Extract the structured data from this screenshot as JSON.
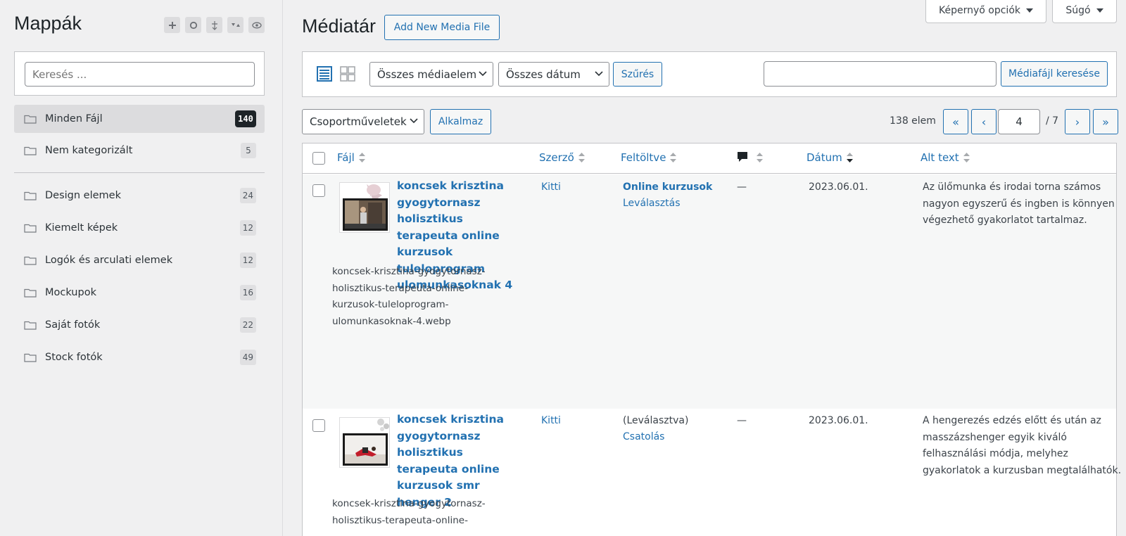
{
  "sidebar": {
    "title": "Mappák",
    "tools": [
      "+",
      "○",
      "⇣",
      "▾▴",
      "👁"
    ],
    "search_placeholder": "Keresés ...",
    "folders_top": [
      {
        "label": "Minden Fájl",
        "count": "140"
      },
      {
        "label": "Nem kategorizált",
        "count": "5"
      }
    ],
    "folders": [
      {
        "label": "Design elemek",
        "count": "24"
      },
      {
        "label": "Kiemelt képek",
        "count": "12"
      },
      {
        "label": "Logók és arculati elemek",
        "count": "12"
      },
      {
        "label": "Mockupok",
        "count": "16"
      },
      {
        "label": "Saját fotók",
        "count": "22"
      },
      {
        "label": "Stock fotók",
        "count": "49"
      }
    ]
  },
  "header": {
    "title": "Médiatár",
    "add_new": "Add New Media File",
    "screen_options": "Képernyő opciók",
    "help": "Súgó"
  },
  "toolbar": {
    "media_filter": "Összes médiaelem",
    "date_filter": "Összes dátum",
    "filter_button": "Szűrés",
    "search_button": "Médiafájl keresése"
  },
  "bulk": {
    "actions": "Csoportműveletek",
    "apply": "Alkalmaz"
  },
  "pagination": {
    "count": "138 elem",
    "first": "«",
    "prev": "‹",
    "current": "4",
    "total": "/ 7",
    "next": "›",
    "last": "»"
  },
  "table": {
    "columns": {
      "file": "Fájl",
      "author": "Szerző",
      "uploaded": "Feltöltve",
      "date": "Dátum",
      "alt": "Alt text"
    },
    "rows": [
      {
        "title": "koncsek krisztina gyogytornasz holisztikus terapeuta online kurzusok tuleloprogram ulomunkasoknak 4",
        "filename": "koncsek-krisztina-gyogytornasz-holisztikus-terapeuta-online-kurzusok-tuleloprogram-ulomunkasoknak-4.webp",
        "author": "Kitti",
        "uploaded_to": "Online kurzusok",
        "uploaded_action": "Leválasztás",
        "comments": "—",
        "date": "2023.06.01.",
        "alt": "Az ülőmunka és irodai torna számos nagyon egyszerű és ingben is könnyen végezhető gyakorlatot tartalmaz."
      },
      {
        "title": "koncsek krisztina gyogytornasz holisztikus terapeuta online kurzusok smr henger 2",
        "filename": "koncsek-krisztina-gyogytornasz-holisztikus-terapeuta-online-",
        "author": "Kitti",
        "uploaded_to": "(Leválasztva)",
        "uploaded_action": "Csatolás",
        "comments": "—",
        "date": "2023.06.01.",
        "alt": "A hengerezés edzés előtt és után az masszázshenger egyik kiváló felhasználási módja, melyhez gyakorlatok a kurzusban megtalálhatók."
      }
    ]
  },
  "colors": {
    "accent": "#2271b1",
    "background": "#f0f0f1"
  }
}
